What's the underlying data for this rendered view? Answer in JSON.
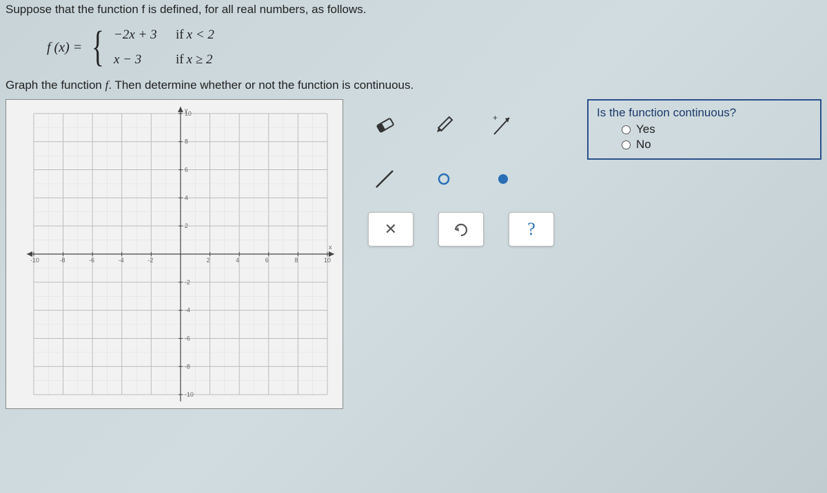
{
  "intro": "Suppose that the function f is defined, for all real numbers, as follows.",
  "lhs": "f (x) =",
  "piece1_expr": "−2x + 3",
  "piece1_cond_if": "if",
  "piece1_cond": "x < 2",
  "piece2_expr": "x − 3",
  "piece2_cond_if": "if",
  "piece2_cond": "x ≥ 2",
  "instruction_pre": "Graph the function ",
  "instruction_mid": "f",
  "instruction_post": ". Then determine whether or not the function is continuous.",
  "question": "Is the function continuous?",
  "opt_yes": "Yes",
  "opt_no": "No",
  "toolbar": {
    "clear": "✕",
    "undo_icon": "undo",
    "help": "?"
  },
  "chart_data": {
    "type": "scatter",
    "title": "",
    "xlabel": "x",
    "ylabel": "y",
    "xlim": [
      -10,
      10
    ],
    "ylim": [
      -10,
      10
    ],
    "x_ticks": [
      -10,
      -8,
      -6,
      -4,
      -2,
      0,
      2,
      4,
      6,
      8,
      10
    ],
    "y_ticks": [
      -10,
      -8,
      -6,
      -4,
      -2,
      0,
      2,
      4,
      6,
      8,
      10
    ],
    "series": []
  }
}
